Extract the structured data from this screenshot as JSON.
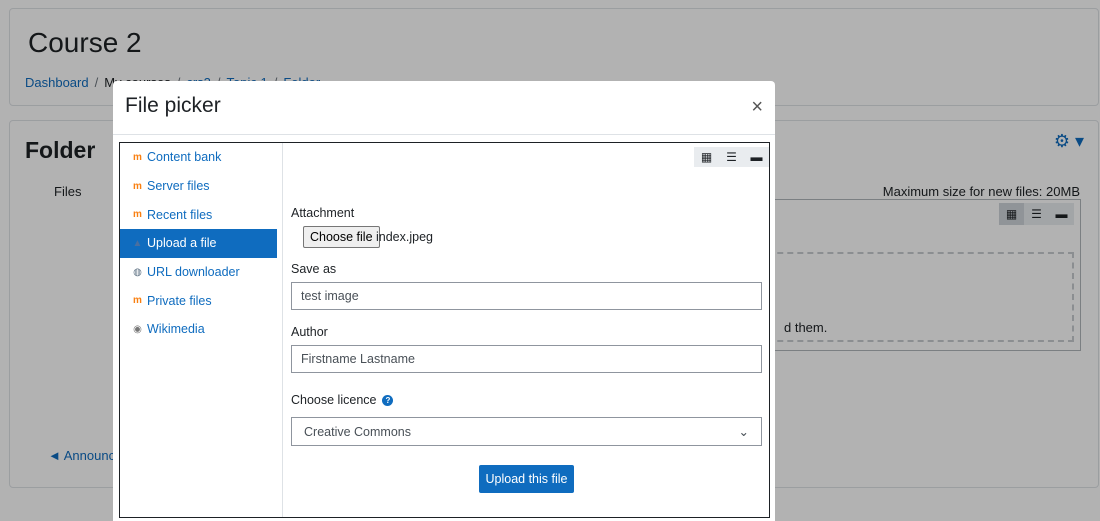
{
  "page": {
    "course_title": "Course 2",
    "breadcrumb": [
      "Dashboard",
      "My courses",
      "crs2",
      "Topic 1",
      "Folder"
    ],
    "breadcrumb_sep": "/",
    "folder_title": "Folder",
    "files_label": "Files",
    "max_size": "Maximum size for new files: 20MB",
    "drop_text": "d them.",
    "announcements_link": "◄ Announc"
  },
  "modal": {
    "title": "File picker",
    "close": "×",
    "repositories": [
      {
        "label": "Content bank",
        "icon": "moodle-icon"
      },
      {
        "label": "Server files",
        "icon": "moodle-icon"
      },
      {
        "label": "Recent files",
        "icon": "moodle-icon"
      },
      {
        "label": "Upload a file",
        "icon": "upload-icon",
        "active": true
      },
      {
        "label": "URL downloader",
        "icon": "url-icon"
      },
      {
        "label": "Private files",
        "icon": "moodle-icon"
      },
      {
        "label": "Wikimedia",
        "icon": "wikimedia-icon"
      }
    ],
    "form": {
      "attachment_label": "Attachment",
      "choose_file_label": "Choose file",
      "file_name": "index.jpeg",
      "save_as_label": "Save as",
      "save_as_value": "test image",
      "author_label": "Author",
      "author_value": "Firstname Lastname",
      "licence_label": "Choose licence",
      "licence_value": "Creative Commons",
      "upload_button": "Upload this file"
    }
  }
}
